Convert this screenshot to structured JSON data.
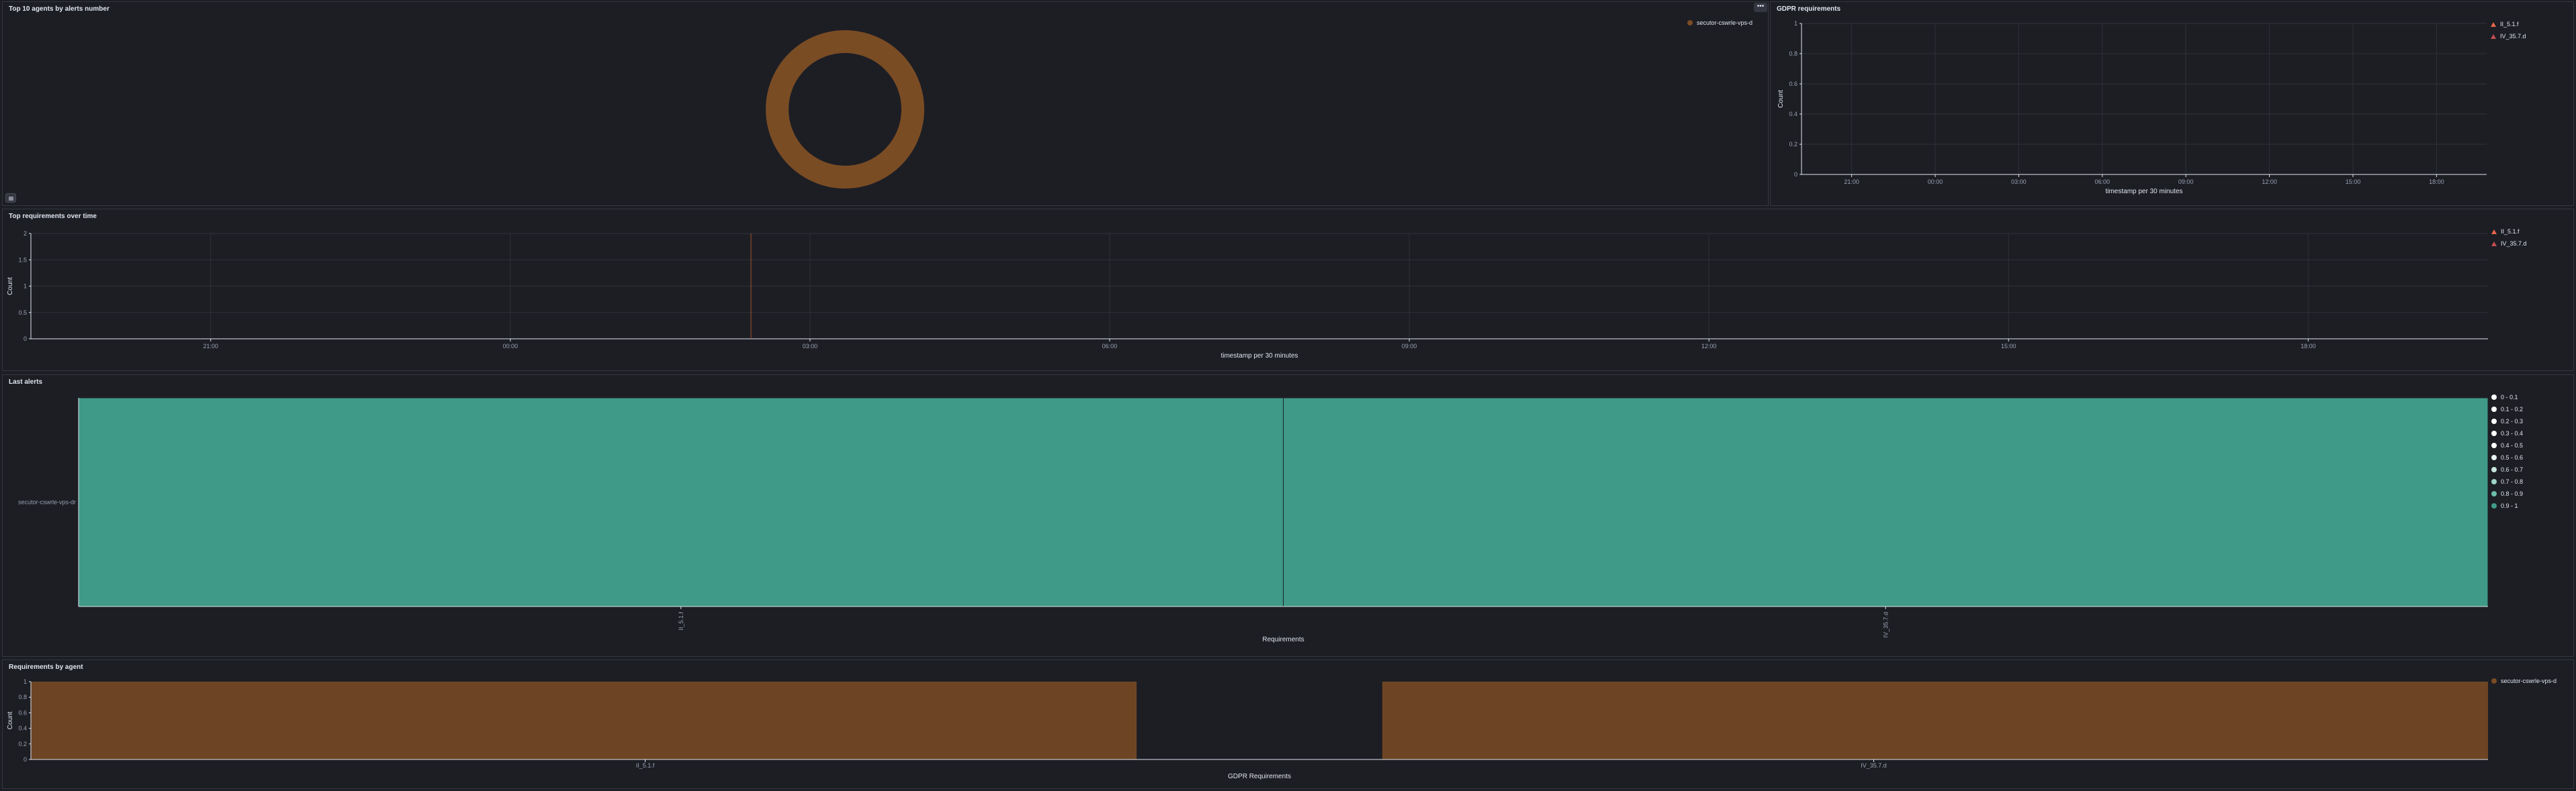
{
  "panels": {
    "top_agents": {
      "title": "Top 10 agents by alerts number",
      "legend": [
        "secutor-cswrle-vps-d"
      ],
      "options_label": "•••",
      "colors": {
        "slice": "#7a4c24"
      }
    },
    "gdpr": {
      "title": "GDPR requirements",
      "legend": [
        "II_5.1.f",
        "IV_35.7.d"
      ],
      "y_ticks": [
        "1",
        "0.8",
        "0.6",
        "0.4",
        "0.2",
        "0"
      ],
      "x_ticks": [
        "21:00",
        "00:00",
        "03:00",
        "06:00",
        "09:00",
        "12:00",
        "15:00",
        "18:00"
      ],
      "y_label": "Count",
      "x_label": "timestamp per 30 minutes"
    },
    "top_requirements": {
      "title": "Top requirements over time",
      "legend": [
        "II_5.1.f",
        "IV_35.7.d"
      ],
      "y_ticks": [
        "2",
        "1.5",
        "1",
        "0.5",
        "0"
      ],
      "x_ticks": [
        "21:00",
        "00:00",
        "03:00",
        "06:00",
        "09:00",
        "12:00",
        "15:00",
        "18:00"
      ],
      "y_label": "Count",
      "x_label": "timestamp per 30 minutes"
    },
    "last_alerts": {
      "title": "Last alerts",
      "y_label": "secutor-cswrle-vps-dr",
      "x_ticks": [
        "II_5.1.f",
        "IV_35.7.d"
      ],
      "x_label": "Requirements",
      "legend": [
        {
          "label": "0 - 0.1",
          "color": "#ffffff"
        },
        {
          "label": "0.1 - 0.2",
          "color": "#ffffff"
        },
        {
          "label": "0.2 - 0.3",
          "color": "#ffffff"
        },
        {
          "label": "0.3 - 0.4",
          "color": "#ffffff"
        },
        {
          "label": "0.4 - 0.5",
          "color": "#ffffff"
        },
        {
          "label": "0.5 - 0.6",
          "color": "#e8f4f1"
        },
        {
          "label": "0.6 - 0.7",
          "color": "#c7e6de"
        },
        {
          "label": "0.7 - 0.8",
          "color": "#9fd4c7"
        },
        {
          "label": "0.8 - 0.9",
          "color": "#6dbdab"
        },
        {
          "label": "0.9 - 1",
          "color": "#3f9a87"
        }
      ],
      "colors": {
        "cell": "#3f9a87"
      }
    },
    "requirements_by_agent": {
      "title": "Requirements by agent",
      "legend": [
        "secutor-cswrle-vps-d"
      ],
      "y_ticks": [
        "1",
        "0.8",
        "0.6",
        "0.4",
        "0.2",
        "0"
      ],
      "x_ticks": [
        "II_5.1.f",
        "IV_35.7.d"
      ],
      "y_label": "Count",
      "x_label": "GDPR Requirements",
      "colors": {
        "bar": "#6d4524"
      }
    }
  },
  "chart_data": [
    {
      "type": "pie",
      "title": "Top 10 agents by alerts number",
      "categories": [
        "secutor-cswrle-vps-d"
      ],
      "values": [
        1
      ],
      "donut": true
    },
    {
      "type": "line",
      "title": "GDPR requirements",
      "xlabel": "timestamp per 30 minutes",
      "ylabel": "Count",
      "ylim": [
        0,
        1
      ],
      "series": [
        {
          "name": "II_5.1.f",
          "values": []
        },
        {
          "name": "IV_35.7.d",
          "values": []
        }
      ],
      "grid": true
    },
    {
      "type": "line",
      "title": "Top requirements over time",
      "xlabel": "timestamp per 30 minutes",
      "ylabel": "Count",
      "ylim": [
        0,
        2
      ],
      "series": [
        {
          "name": "II_5.1.f",
          "values": []
        },
        {
          "name": "IV_35.7.d",
          "values": []
        }
      ],
      "grid": true
    },
    {
      "type": "heatmap",
      "title": "Last alerts",
      "xlabel": "Requirements",
      "categories": [
        "II_5.1.f",
        "IV_35.7.d"
      ],
      "rows": [
        "secutor-cswrle-vps-dr"
      ],
      "values": [
        [
          1,
          1
        ]
      ]
    },
    {
      "type": "bar",
      "title": "Requirements by agent",
      "xlabel": "GDPR Requirements",
      "ylabel": "Count",
      "ylim": [
        0,
        1
      ],
      "categories": [
        "II_5.1.f",
        "IV_35.7.d"
      ],
      "series": [
        {
          "name": "secutor-cswrle-vps-d",
          "values": [
            1,
            1
          ]
        }
      ]
    }
  ]
}
